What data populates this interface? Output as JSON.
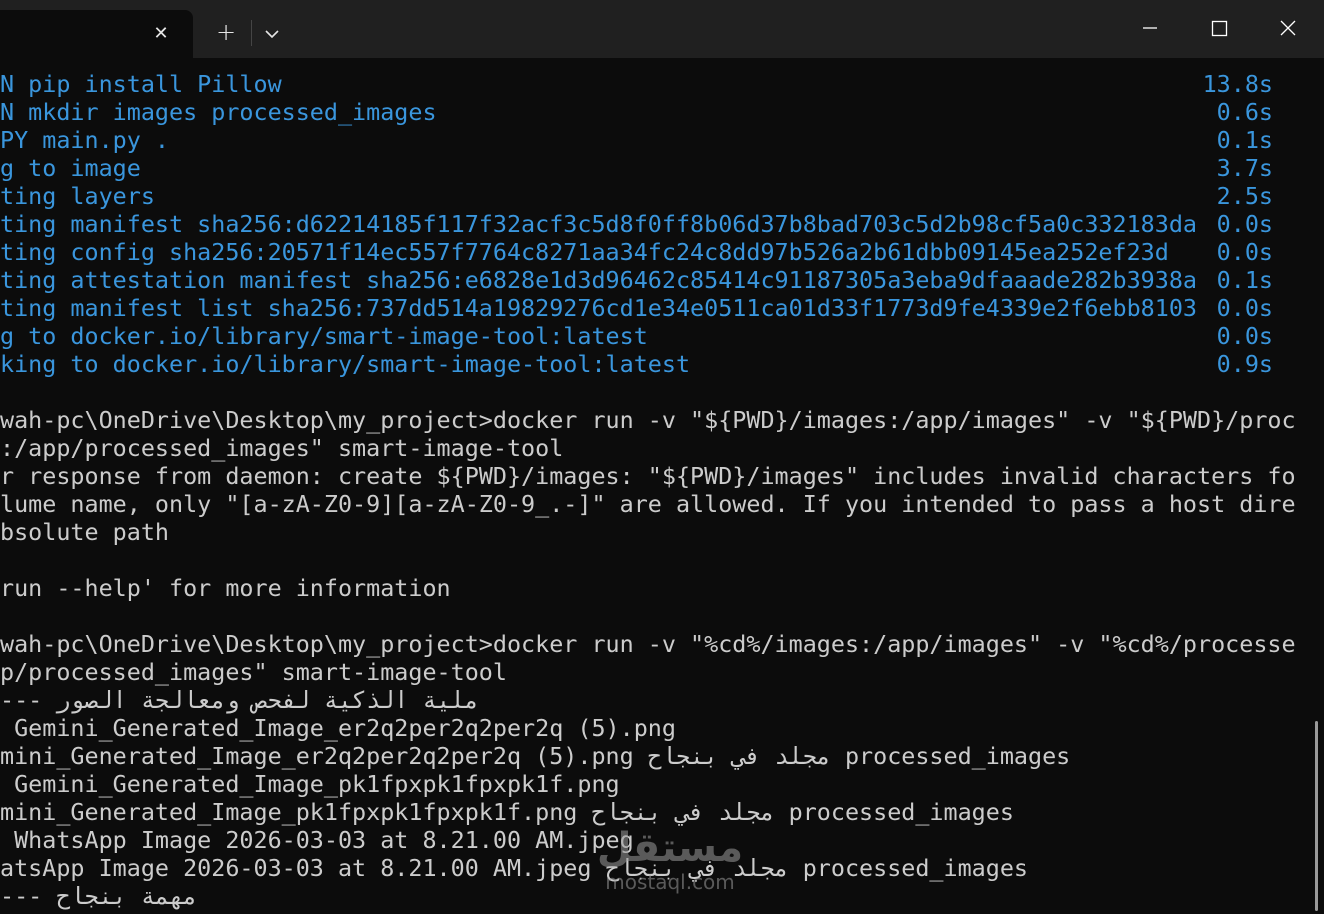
{
  "window": {
    "controls": {
      "minimize_icon": "minimize-icon",
      "maximize_icon": "maximize-icon",
      "close_icon": "close-icon"
    }
  },
  "colors": {
    "background": "#0c0c0c",
    "titlebar": "#202020",
    "step_text": "#3a96dd",
    "text": "#cccccc"
  },
  "tab": {
    "close_glyph": "✕",
    "new_tab_glyph": "+"
  },
  "terminal": {
    "build_steps": [
      {
        "text": "N pip install Pillow",
        "time": "13.8s"
      },
      {
        "text": "N mkdir images processed_images",
        "time": "0.6s"
      },
      {
        "text": "PY main.py .",
        "time": "0.1s"
      },
      {
        "text": "g to image",
        "time": "3.7s"
      },
      {
        "text": "ting layers",
        "time": "2.5s"
      },
      {
        "text": "ting manifest sha256:d62214185f117f32acf3c5d8f0ff8b06d37b8bad703c5d2b98cf5a0c332183da",
        "time": "0.0s"
      },
      {
        "text": "ting config sha256:20571f14ec557f7764c8271aa34fc24c8dd97b526a2b61dbb09145ea252ef23d",
        "time": "0.0s"
      },
      {
        "text": "ting attestation manifest sha256:e6828e1d3d96462c85414c91187305a3eba9dfaaade282b3938a",
        "time": "0.1s"
      },
      {
        "text": "ting manifest list sha256:737dd514a19829276cd1e34e0511ca01d33f1773d9fe4339e2f6ebb8103",
        "time": "0.0s"
      },
      {
        "text": "g to docker.io/library/smart-image-tool:latest",
        "time": "0.0s"
      },
      {
        "text": "king to docker.io/library/smart-image-tool:latest",
        "time": "0.9s"
      }
    ],
    "output_lines": [
      "",
      "wah-pc\\OneDrive\\Desktop\\my_project>docker run -v \"${PWD}/images:/app/images\" -v \"${PWD}/proc",
      ":/app/processed_images\" smart-image-tool",
      "r response from daemon: create ${PWD}/images: \"${PWD}/images\" includes invalid characters fo",
      "lume name, only \"[a-zA-Z0-9][a-zA-Z0-9_.-]\" are allowed. If you intended to pass a host dire",
      "bsolute path",
      "",
      "run --help' for more information",
      "",
      "wah-pc\\OneDrive\\Desktop\\my_project>docker run -v \"%cd%/images:/app/images\" -v \"%cd%/processe",
      "p/processed_images\" smart-image-tool",
      "‭--- روصلا ةجلاعمو صحفل ةيكذلا ةيلم‬",
      " Gemini_Generated_Image_er2q2per2q2per2q (5).png",
      "‭mini_Generated_Image_er2q2per2q2per2q (5).png حاجنب يف دلجم processed_images‬",
      " Gemini_Generated_Image_pk1fpxpk1fpxpk1f.png",
      "‭mini_Generated_Image_pk1fpxpk1fpxpk1f.png حاجنب يف دلجم processed_images‬",
      " WhatsApp Image 2026-03-03 at 8.21.00 AM.jpeg",
      "‭atsApp Image 2026-03-03 at 8.21.00 AM.jpeg حاجنب يف دلجم processed_images‬",
      "‭--- حاجنب ةمهم‬"
    ]
  },
  "watermark": {
    "logo": "مستقل",
    "text": "mostaql.com"
  }
}
